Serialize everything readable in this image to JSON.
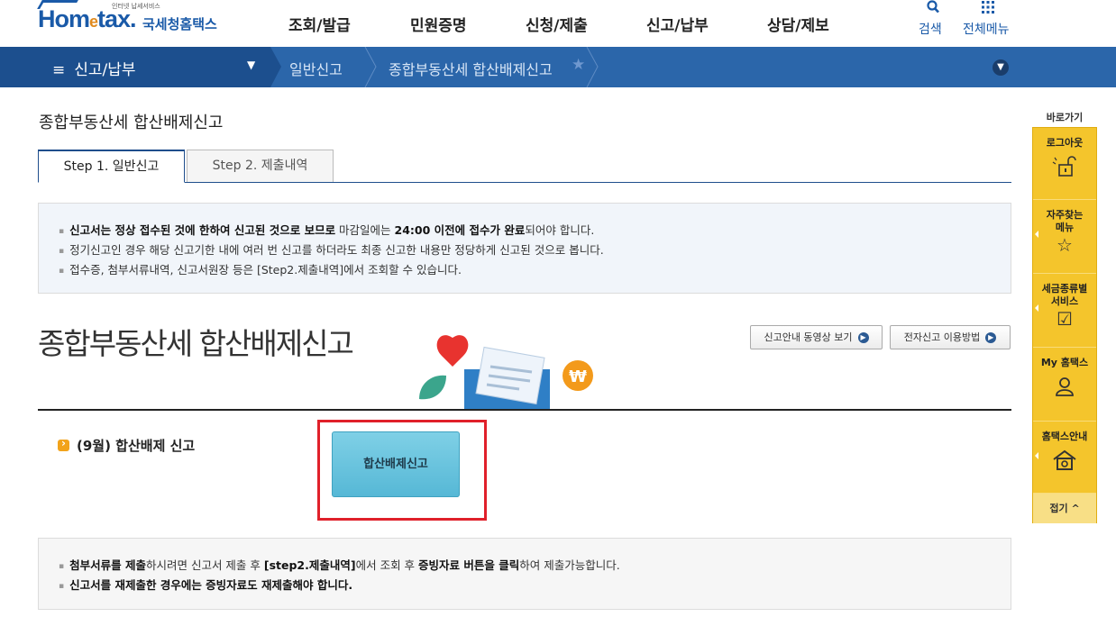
{
  "header": {
    "logo_small": "인터넷 납세서비스",
    "logo_main_left": "Hom",
    "logo_main_e": "e",
    "logo_main_right": "tax.",
    "logo_kor": "국세청홈택스",
    "nav": [
      "조회/발급",
      "민원증명",
      "신청/제출",
      "신고/납부",
      "상담/제보"
    ],
    "search_label": "검색",
    "all_menu_label": "전체메뉴"
  },
  "location": {
    "menu_title": "신고/납부",
    "crumb1": "일반신고",
    "crumb2": "종합부동산세 합산배제신고"
  },
  "page": {
    "title": "종합부동산세 합산배제신고",
    "tabs": [
      "Step 1. 일반신고",
      "Step 2. 제출내역"
    ]
  },
  "notice_top": {
    "line1_b1": "신고서는 정상 접수된 것에 한하여 신고된 것으로 보므로",
    "line1_t1": " 마감일에는 ",
    "line1_b2": "24:00 이전에 접수가 완료",
    "line1_t2": "되어야 합니다.",
    "line2": "정기신고인 경우 해당 신고기한 내에 여러 번 신고를 하더라도 최종 신고한 내용만 정당하게 신고된 것으로 봅니다.",
    "line3": "접수증, 첨부서류내역, 신고서원장 등은 [Step2.제출내역]에서 조회할 수 있습니다."
  },
  "hero": {
    "title": "종합부동산세 합산배제신고",
    "video_btn": "신고안내 동영상 보기",
    "guide_btn": "전자신고 이용방법"
  },
  "section": {
    "label": "(9월) 합산배제 신고",
    "main_button": "합산배제신고"
  },
  "notice_bottom": {
    "l1_b1": "첨부서류를 제출",
    "l1_t1": "하시려면 신고서 제출 후 ",
    "l1_b2": "[step2.제출내역]",
    "l1_t2": "에서 조회 후 ",
    "l1_b3": "증빙자료 버튼을 클릭",
    "l1_t3": "하여 제출가능합니다.",
    "l2": "신고서를 재제출한 경우에는 증빙자료도 재제출해야 합니다."
  },
  "quick_menu": {
    "title": "바로가기",
    "items": [
      "로그아웃",
      "자주찾는 메뉴",
      "세금종류별 서비스",
      "My 홈택스",
      "홈택스안내"
    ],
    "fold": "접기"
  },
  "colors": {
    "brand_blue": "#2b66aa",
    "quick_yellow": "#f4c52c",
    "highlight_red": "#e0202a",
    "main_button": "#6cc5df"
  }
}
